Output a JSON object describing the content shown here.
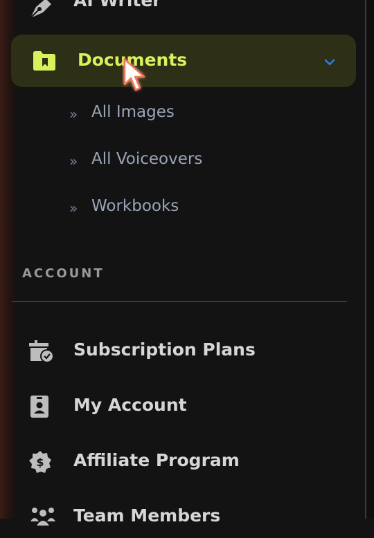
{
  "sidebar": {
    "top_item": {
      "label": "AI Writer",
      "icon": "pen-nib-icon"
    },
    "active_item": {
      "label": "Documents",
      "icon": "folder-bookmark-icon",
      "expand_icon": "chevron-down-icon"
    },
    "sub_items": [
      {
        "label": "All Images"
      },
      {
        "label": "All Voiceovers"
      },
      {
        "label": "Workbooks"
      }
    ],
    "account_heading": "ACCOUNT",
    "account_items": [
      {
        "label": "Subscription Plans",
        "icon": "box-check-icon"
      },
      {
        "label": "My Account",
        "icon": "id-badge-icon"
      },
      {
        "label": "Affiliate Program",
        "icon": "dollar-badge-icon"
      },
      {
        "label": "Team Members",
        "icon": "users-icon"
      }
    ]
  },
  "colors": {
    "background": "#131313",
    "active_background": "#2d2f16",
    "active_text": "#d7f25b",
    "chevron": "#2f7fe0",
    "text": "#d6d6d6",
    "sub_text": "#9aa4b8"
  }
}
